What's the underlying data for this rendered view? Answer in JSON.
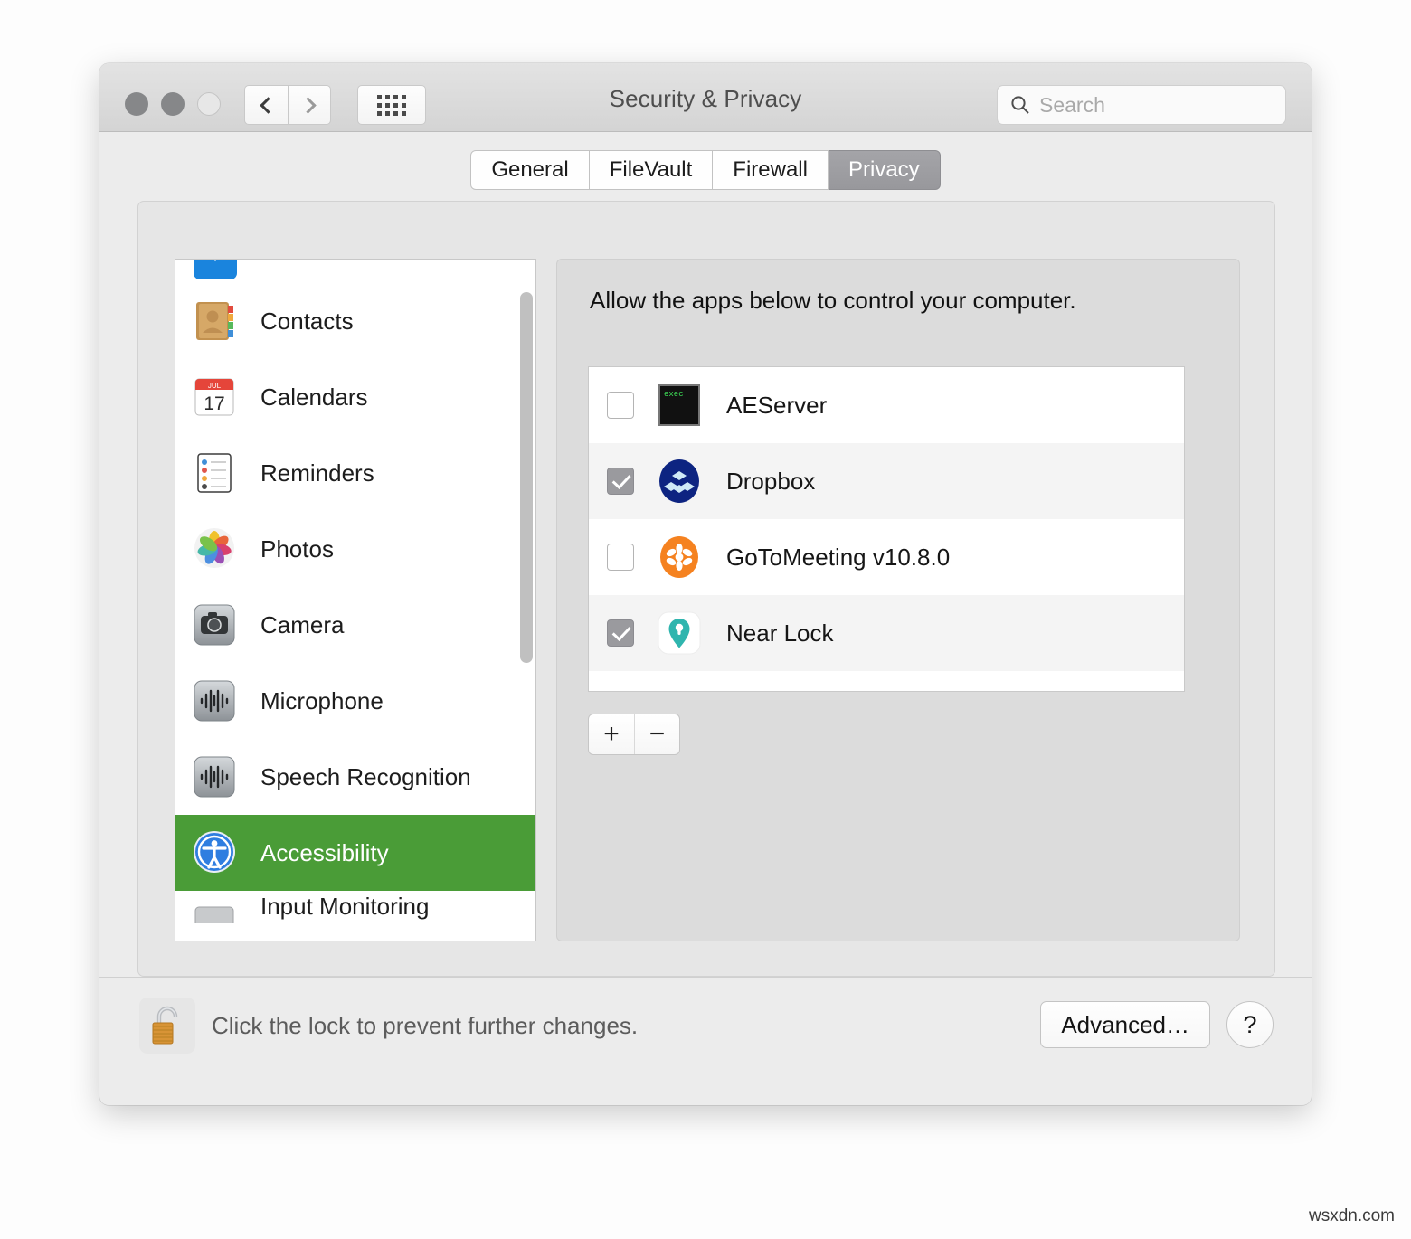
{
  "window": {
    "title": "Security & Privacy",
    "traffic_lights": [
      "close",
      "minimize",
      "zoom"
    ]
  },
  "toolbar": {
    "back_icon": "chevron-left-icon",
    "forward_icon": "chevron-right-icon",
    "grid_icon": "show-all-grid-icon",
    "search": {
      "placeholder": "Search",
      "value": "",
      "icon": "search-icon"
    }
  },
  "tabs": [
    {
      "label": "General",
      "selected": false
    },
    {
      "label": "FileVault",
      "selected": false
    },
    {
      "label": "Firewall",
      "selected": false
    },
    {
      "label": "Privacy",
      "selected": true
    }
  ],
  "sidebar": {
    "scroll_position": "middle",
    "items": [
      {
        "label": "",
        "icon": "files-and-folders-icon",
        "selected": false,
        "clipped": "top"
      },
      {
        "label": "Contacts",
        "icon": "contacts-icon",
        "selected": false
      },
      {
        "label": "Calendars",
        "icon": "calendar-icon",
        "selected": false
      },
      {
        "label": "Reminders",
        "icon": "reminders-icon",
        "selected": false
      },
      {
        "label": "Photos",
        "icon": "photos-icon",
        "selected": false
      },
      {
        "label": "Camera",
        "icon": "camera-icon",
        "selected": false
      },
      {
        "label": "Microphone",
        "icon": "microphone-icon",
        "selected": false
      },
      {
        "label": "Speech Recognition",
        "icon": "speech-recognition-icon",
        "selected": false
      },
      {
        "label": "Accessibility",
        "icon": "accessibility-icon",
        "selected": true
      },
      {
        "label": "Input Monitoring",
        "icon": "input-monitoring-icon",
        "selected": false,
        "clipped": "bottom"
      }
    ]
  },
  "panel": {
    "description": "Allow the apps below to control your computer.",
    "apps": [
      {
        "name": "AEServer",
        "checked": false,
        "icon": "terminal-exec-icon"
      },
      {
        "name": "Dropbox",
        "checked": true,
        "icon": "dropbox-icon"
      },
      {
        "name": "GoToMeeting v10.8.0",
        "checked": false,
        "icon": "gotomeeting-icon"
      },
      {
        "name": "Near Lock",
        "checked": true,
        "icon": "near-lock-pin-icon"
      }
    ],
    "add_label": "+",
    "remove_label": "−"
  },
  "bottom": {
    "lock_icon": "padlock-open-icon",
    "lock_text": "Click the lock to prevent further changes.",
    "advanced_label": "Advanced…",
    "help_label": "?"
  },
  "watermark": "wsxdn.com",
  "colors": {
    "selection_green": "#4a9c37",
    "tab_selected_gray": "#9c9ca0",
    "dropbox_blue": "#0d2481",
    "gotomeeting_orange": "#f58220",
    "near_lock_teal": "#2fb5ae",
    "lock_gold": "#d89436"
  }
}
